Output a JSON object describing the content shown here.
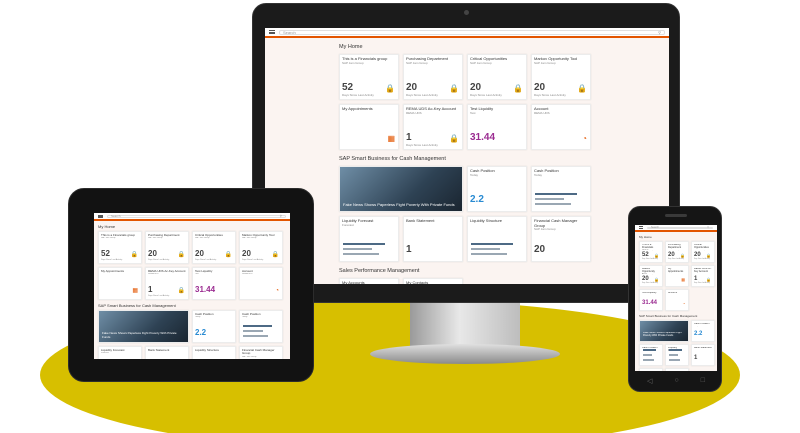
{
  "search_placeholder": "Search",
  "home": {
    "title": "My Home",
    "tiles": [
      {
        "title": "This is a Financials group",
        "subtitle": "SAP Jam Group",
        "value": "52",
        "foot": "Days Since Last Activity",
        "icon": "lock-icon"
      },
      {
        "title": "Purchasing Department",
        "subtitle": "SAP Jam Group",
        "value": "20",
        "foot": "Days Since Last Activity",
        "icon": "lock-icon"
      },
      {
        "title": "Critical Opportunities",
        "subtitle": "SAP Jam Group",
        "value": "20",
        "foot": "Days Since Last Activity",
        "icon": "lock-icon"
      },
      {
        "title": "Markov Opportunity Tool",
        "subtitle": "SAP Jam Group",
        "value": "20",
        "foot": "Days Since Last Activity",
        "icon": "lock-icon"
      },
      {
        "title": "My Appointments",
        "subtitle": "",
        "value": "",
        "foot": "",
        "icon": "calendar-icon"
      },
      {
        "title": "REMA UDS Ac-Key Account",
        "subtitle": "REMA UDS",
        "value": "1",
        "foot": "Days Since Last Activity",
        "icon": "lock-icon"
      },
      {
        "title": "Test Liquidity",
        "subtitle": "Test",
        "value": "31.44",
        "foot": "",
        "icon": ""
      },
      {
        "title": "Account",
        "subtitle": "REMA UDS",
        "value": "",
        "foot": "",
        "icon": "refresh-icon"
      }
    ]
  },
  "cash": {
    "title": "SAP Smart Business for Cash Management",
    "tiles": [
      {
        "title": "Fake News Shows Paperless Fight Poverty With Private Funds",
        "type": "image"
      },
      {
        "title": "Cash Position",
        "subtitle": "Today",
        "value": "2.2",
        "type": "kpi"
      },
      {
        "title": "Cash Position",
        "subtitle": "Today",
        "type": "bars"
      },
      {
        "title": "Liquidity Forecast",
        "subtitle": "Forecast",
        "type": "chart"
      },
      {
        "title": "Bank Statement",
        "subtitle": "",
        "value": "1",
        "type": "kpi"
      },
      {
        "title": "Liquidity Structure",
        "subtitle": "",
        "type": "bars"
      },
      {
        "title": "Financial Cash Manager Group",
        "subtitle": "SAP Jam Group",
        "value": "20",
        "type": "kpi"
      }
    ]
  },
  "sales": {
    "title": "Sales Performance Management",
    "tiles": [
      {
        "title": "My Accounts"
      },
      {
        "title": "My Contacts"
      }
    ]
  }
}
